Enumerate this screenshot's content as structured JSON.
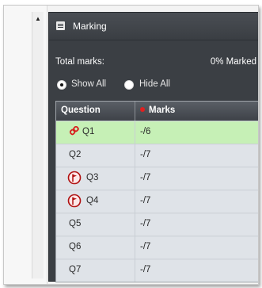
{
  "panel": {
    "title": "Marking",
    "total_label": "Total marks:",
    "total_value": "0% Marked"
  },
  "filters": {
    "show_all": "Show All",
    "hide_all": "Hide All",
    "selected": "show_all"
  },
  "table": {
    "col_question": "Question",
    "col_marks": "Marks",
    "rows": [
      {
        "q": "Q1",
        "marks": "-/6",
        "icon": "link-icon",
        "selected": true
      },
      {
        "q": "Q2",
        "marks": "-/7",
        "icon": "",
        "selected": false
      },
      {
        "q": "Q3",
        "marks": "-/7",
        "icon": "flag-icon",
        "selected": false
      },
      {
        "q": "Q4",
        "marks": "-/7",
        "icon": "flag-icon",
        "selected": false
      },
      {
        "q": "Q5",
        "marks": "-/7",
        "icon": "",
        "selected": false
      },
      {
        "q": "Q6",
        "marks": "-/7",
        "icon": "",
        "selected": false
      },
      {
        "q": "Q7",
        "marks": "-/7",
        "icon": "",
        "selected": false
      }
    ]
  },
  "colors": {
    "panel_bg": "#3b3f44",
    "selected_row": "#c6f0b6",
    "marks_dot": "#e02020",
    "flag_red": "#b01010",
    "link_red": "#d81e1e"
  }
}
